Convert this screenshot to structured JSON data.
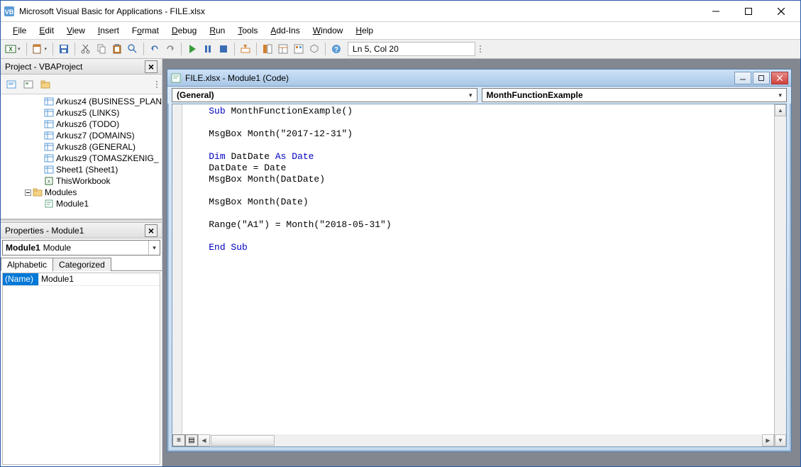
{
  "titlebar": {
    "title": "Microsoft Visual Basic for Applications - FILE.xlsx"
  },
  "menu": {
    "items": [
      "File",
      "Edit",
      "View",
      "Insert",
      "Format",
      "Debug",
      "Run",
      "Tools",
      "Add-Ins",
      "Window",
      "Help"
    ]
  },
  "toolbar": {
    "status": "Ln 5, Col 20"
  },
  "project_pane": {
    "title": "Project - VBAProject",
    "items": [
      {
        "label": "Arkusz4 (BUSINESS_PLAN",
        "indent": 3,
        "icon": "sheet"
      },
      {
        "label": "Arkusz5 (LINKS)",
        "indent": 3,
        "icon": "sheet"
      },
      {
        "label": "Arkusz6 (TODO)",
        "indent": 3,
        "icon": "sheet"
      },
      {
        "label": "Arkusz7 (DOMAINS)",
        "indent": 3,
        "icon": "sheet"
      },
      {
        "label": "Arkusz8 (GENERAL)",
        "indent": 3,
        "icon": "sheet"
      },
      {
        "label": "Arkusz9 (TOMASZKENIG_",
        "indent": 3,
        "icon": "sheet"
      },
      {
        "label": "Sheet1 (Sheet1)",
        "indent": 3,
        "icon": "sheet"
      },
      {
        "label": "ThisWorkbook",
        "indent": 3,
        "icon": "book"
      },
      {
        "label": "Modules",
        "indent": 2,
        "icon": "folder",
        "exp": "-"
      },
      {
        "label": "Module1",
        "indent": 3,
        "icon": "module"
      }
    ]
  },
  "properties_pane": {
    "title": "Properties - Module1",
    "object_name": "Module1",
    "object_type": "Module",
    "tabs": [
      "Alphabetic",
      "Categorized"
    ],
    "rows": [
      {
        "name": "(Name)",
        "value": "Module1"
      }
    ]
  },
  "code_window": {
    "title": "FILE.xlsx - Module1 (Code)",
    "combo_left": "(General)",
    "combo_right": "MonthFunctionExample",
    "code_lines": [
      {
        "t": "Sub ",
        "k": true
      },
      {
        "t": "MonthFunctionExample()\n\n"
      },
      {
        "t": "MsgBox Month(\"2017-12-31\")\n\n"
      },
      {
        "t": "Dim ",
        "k": true
      },
      {
        "t": "DatDate "
      },
      {
        "t": "As Date",
        "k": true
      },
      {
        "t": "\n"
      },
      {
        "t": "DatDate = Date\nMsgBox Month(DatDate)\n\nMsgBox Month(Date)\n\nRange(\"A1\") = Month(\"2018-05-31\")\n\n"
      },
      {
        "t": "End Sub",
        "k": true
      }
    ]
  }
}
